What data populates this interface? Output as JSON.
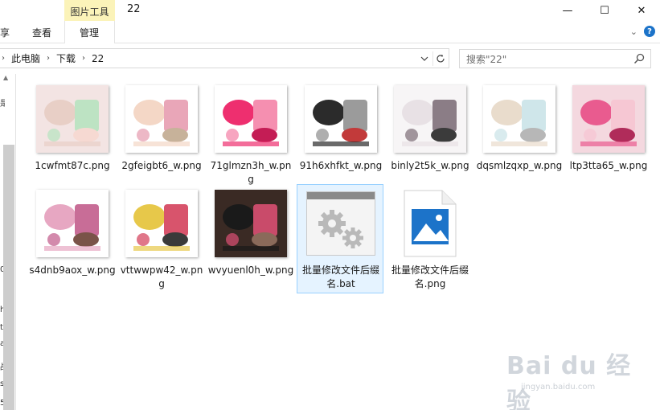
{
  "window": {
    "contextual_tab": "图片工具",
    "title": "22",
    "controls": {
      "minimize": "—",
      "maximize": "☐",
      "close": "✕"
    }
  },
  "ribbon": {
    "tabs": [
      "享",
      "查看",
      "管理"
    ],
    "collapse_chevron": "⌄"
  },
  "address": {
    "breadcrumbs": [
      "此电脑",
      "下载",
      "22"
    ],
    "separator": "›"
  },
  "search": {
    "placeholder": "搜索\"22\""
  },
  "nav_glyphs": [
    "是",
    "0",
    "h",
    "t",
    "a",
    "战",
    "s",
    "5"
  ],
  "files": [
    {
      "name": "1cwfmt87c.png",
      "kind": "photo",
      "palette": [
        "#f3e4e3",
        "#e8cfc6",
        "#bde3c3",
        "#f6d9d2"
      ]
    },
    {
      "name": "2gfeigbt6_w.png",
      "kind": "photo",
      "palette": [
        "#ffffff",
        "#f4d7c6",
        "#e9a6b8",
        "#c7b29a"
      ]
    },
    {
      "name": "71glmzn3h_w.png",
      "kind": "photo",
      "palette": [
        "#ffffff",
        "#ee2f6f",
        "#f58fb0",
        "#c41d55"
      ]
    },
    {
      "name": "91h6xhfkt_w.png",
      "kind": "photo",
      "palette": [
        "#ffffff",
        "#2b2b2b",
        "#9b9b9b",
        "#c23a3a"
      ]
    },
    {
      "name": "binly2t5k_w.png",
      "kind": "photo",
      "palette": [
        "#f7f5f6",
        "#e8e1e5",
        "#8b7d86",
        "#3b3b3b"
      ]
    },
    {
      "name": "dqsmlzqxp_w.png",
      "kind": "photo",
      "palette": [
        "#ffffff",
        "#e9dccc",
        "#cfe6ea",
        "#b7b7b7"
      ]
    },
    {
      "name": "ltp3tta65_w.png",
      "kind": "photo",
      "palette": [
        "#f4d8df",
        "#e95b8f",
        "#f6c7d3",
        "#b02c5a"
      ]
    },
    {
      "name": "s4dnb9aox_w.png",
      "kind": "photo",
      "palette": [
        "#ffffff",
        "#e7a7c2",
        "#c86d97",
        "#7a5348"
      ]
    },
    {
      "name": "vttwwpw42_w.png",
      "kind": "photo",
      "palette": [
        "#ffffff",
        "#e7c84a",
        "#d8546c",
        "#3a3a3a"
      ]
    },
    {
      "name": "wvyuenl0h_w.png",
      "kind": "photo",
      "palette": [
        "#3a2a24",
        "#1a1a1a",
        "#c94b6a",
        "#8a6a5a"
      ]
    },
    {
      "name": "批量修改文件后缀名.bat",
      "kind": "bat",
      "selected": true
    },
    {
      "name": "批量修改文件后缀名.png",
      "kind": "image-doc"
    }
  ],
  "watermark": {
    "main": "Bai du 经验",
    "sub": "jingyan.baidu.com"
  },
  "colors": {
    "accent": "#1c73c9",
    "selection_border": "#99d1ff",
    "selection_fill": "#e5f3ff",
    "context_tab": "#fbf3b9"
  }
}
